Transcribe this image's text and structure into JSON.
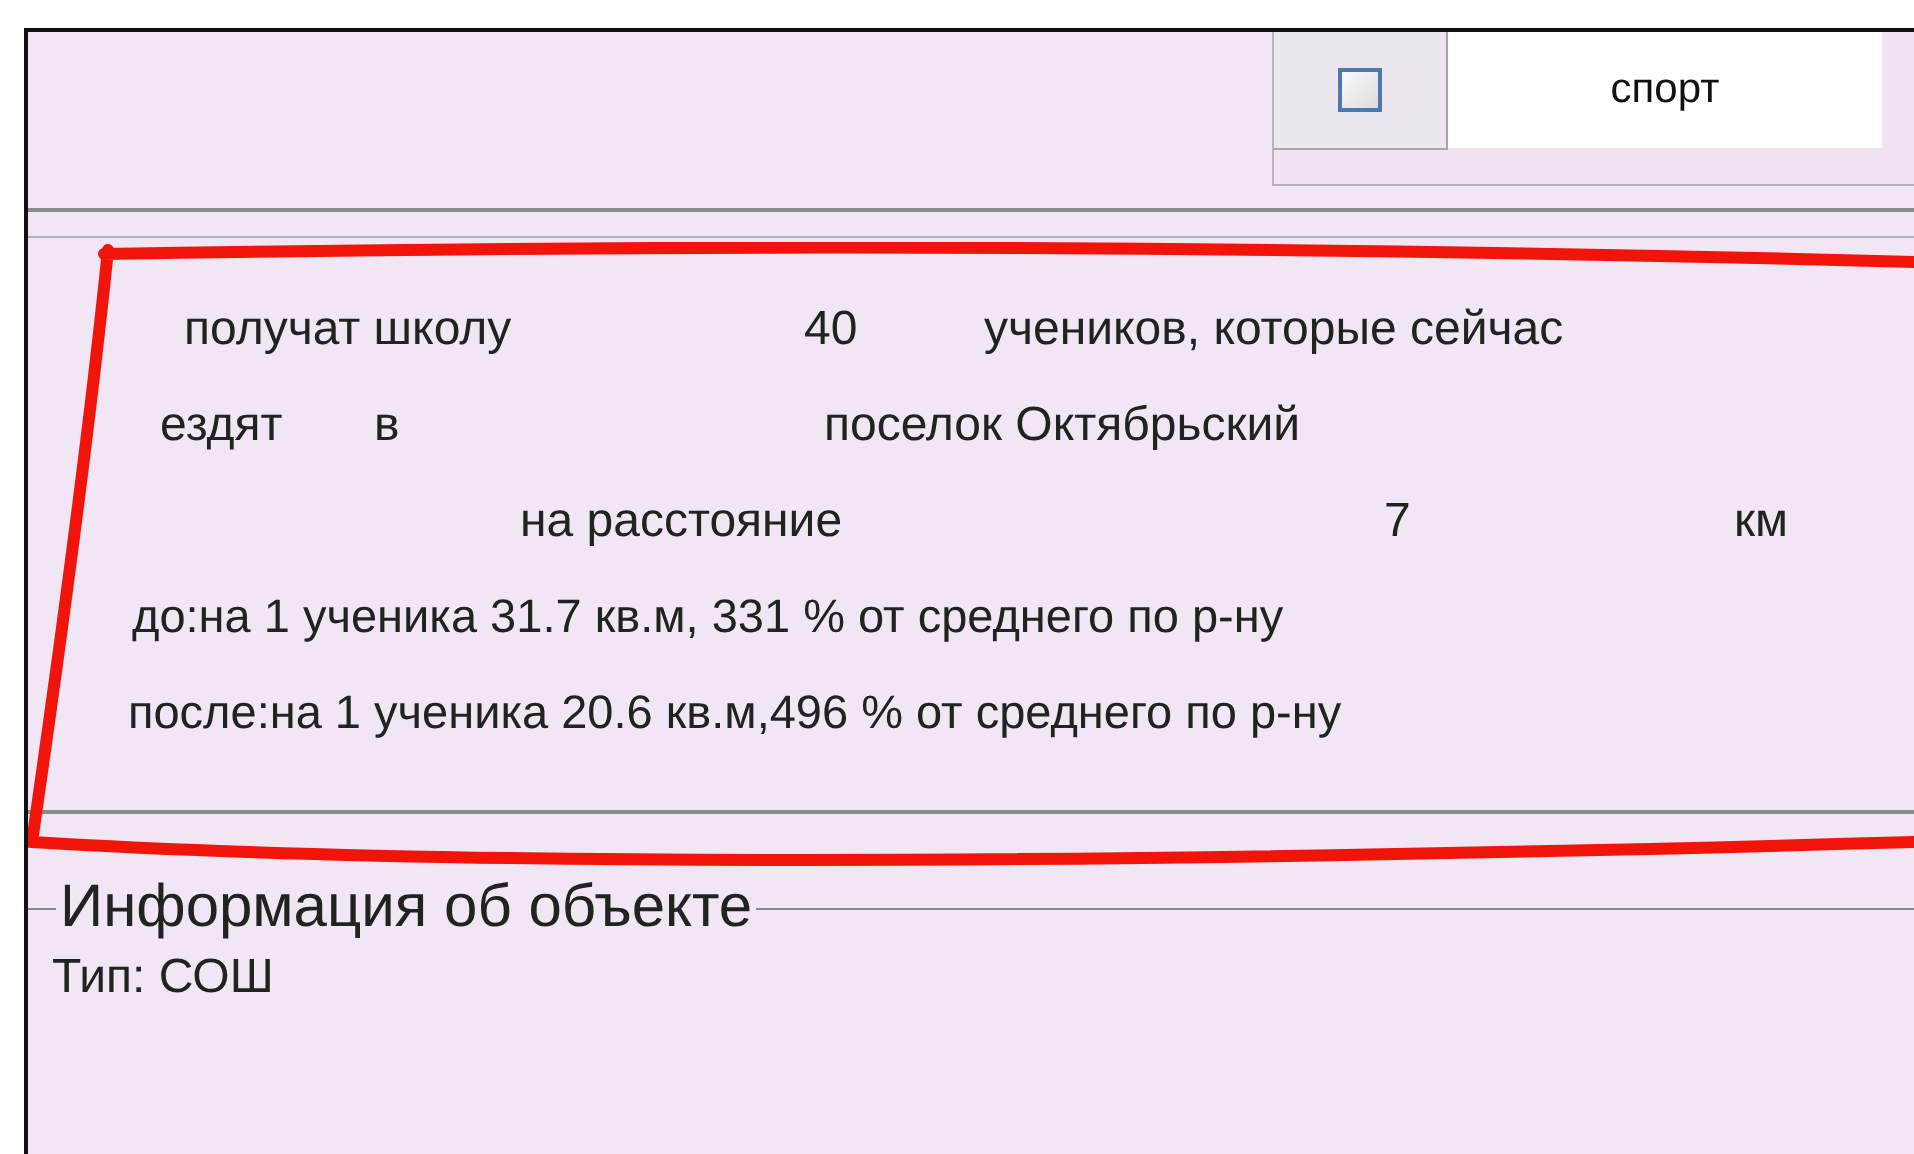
{
  "filter_option": {
    "label": "спорт",
    "checked": false
  },
  "summary": {
    "rows": [
      {
        "segments": [
          "получат школу",
          "40",
          "учеников, которые сейчас"
        ]
      },
      {
        "segments": [
          "ездят",
          "в",
          "поселок Октябрьский"
        ]
      },
      {
        "segments": [
          "на расстояние",
          "7",
          "км"
        ]
      }
    ],
    "before": "до:на 1 ученика 31.7 кв.м, 331 % от среднего по р-ну",
    "after": "после:на 1 ученика 20.6 кв.м,496 % от среднего по р-ну"
  },
  "object_info": {
    "title": "Информация об объекте",
    "type": "Тип: СОШ"
  }
}
